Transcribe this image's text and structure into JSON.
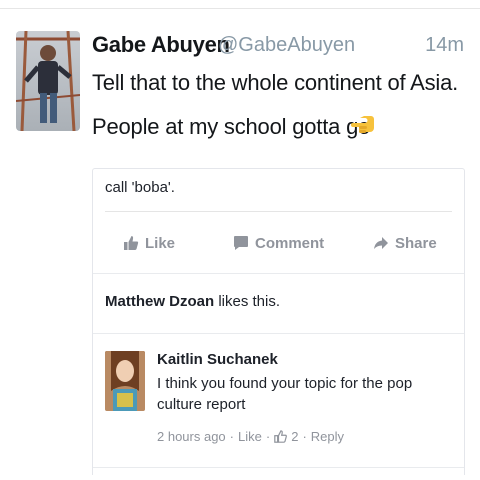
{
  "tweet": {
    "author": "Gabe Abuyen",
    "handle": "@GabeAbuyen",
    "time": "14m",
    "line1": "Tell that to the whole continent of Asia.",
    "line2": "People at my school gotta go"
  },
  "card": {
    "text": "call 'boba'.",
    "actions": {
      "like": "Like",
      "comment": "Comment",
      "share": "Share"
    },
    "likes": {
      "name": "Matthew Dzoan",
      "suffix": "likes this."
    },
    "comment": {
      "author": "Kaitlin Suchanek",
      "text": "I think you found your topic for the pop culture report",
      "time": "2 hours ago",
      "like": "Like",
      "sep": "·",
      "like_count": "2",
      "reply": "Reply"
    }
  },
  "colors": {
    "muted": "#8899a6",
    "fb_gray": "#90949c",
    "emoji": "#f7c23c"
  },
  "icons": [
    "pointing-hand-emoji",
    "thumbs-up-icon",
    "comment-icon",
    "share-arrow-icon"
  ]
}
